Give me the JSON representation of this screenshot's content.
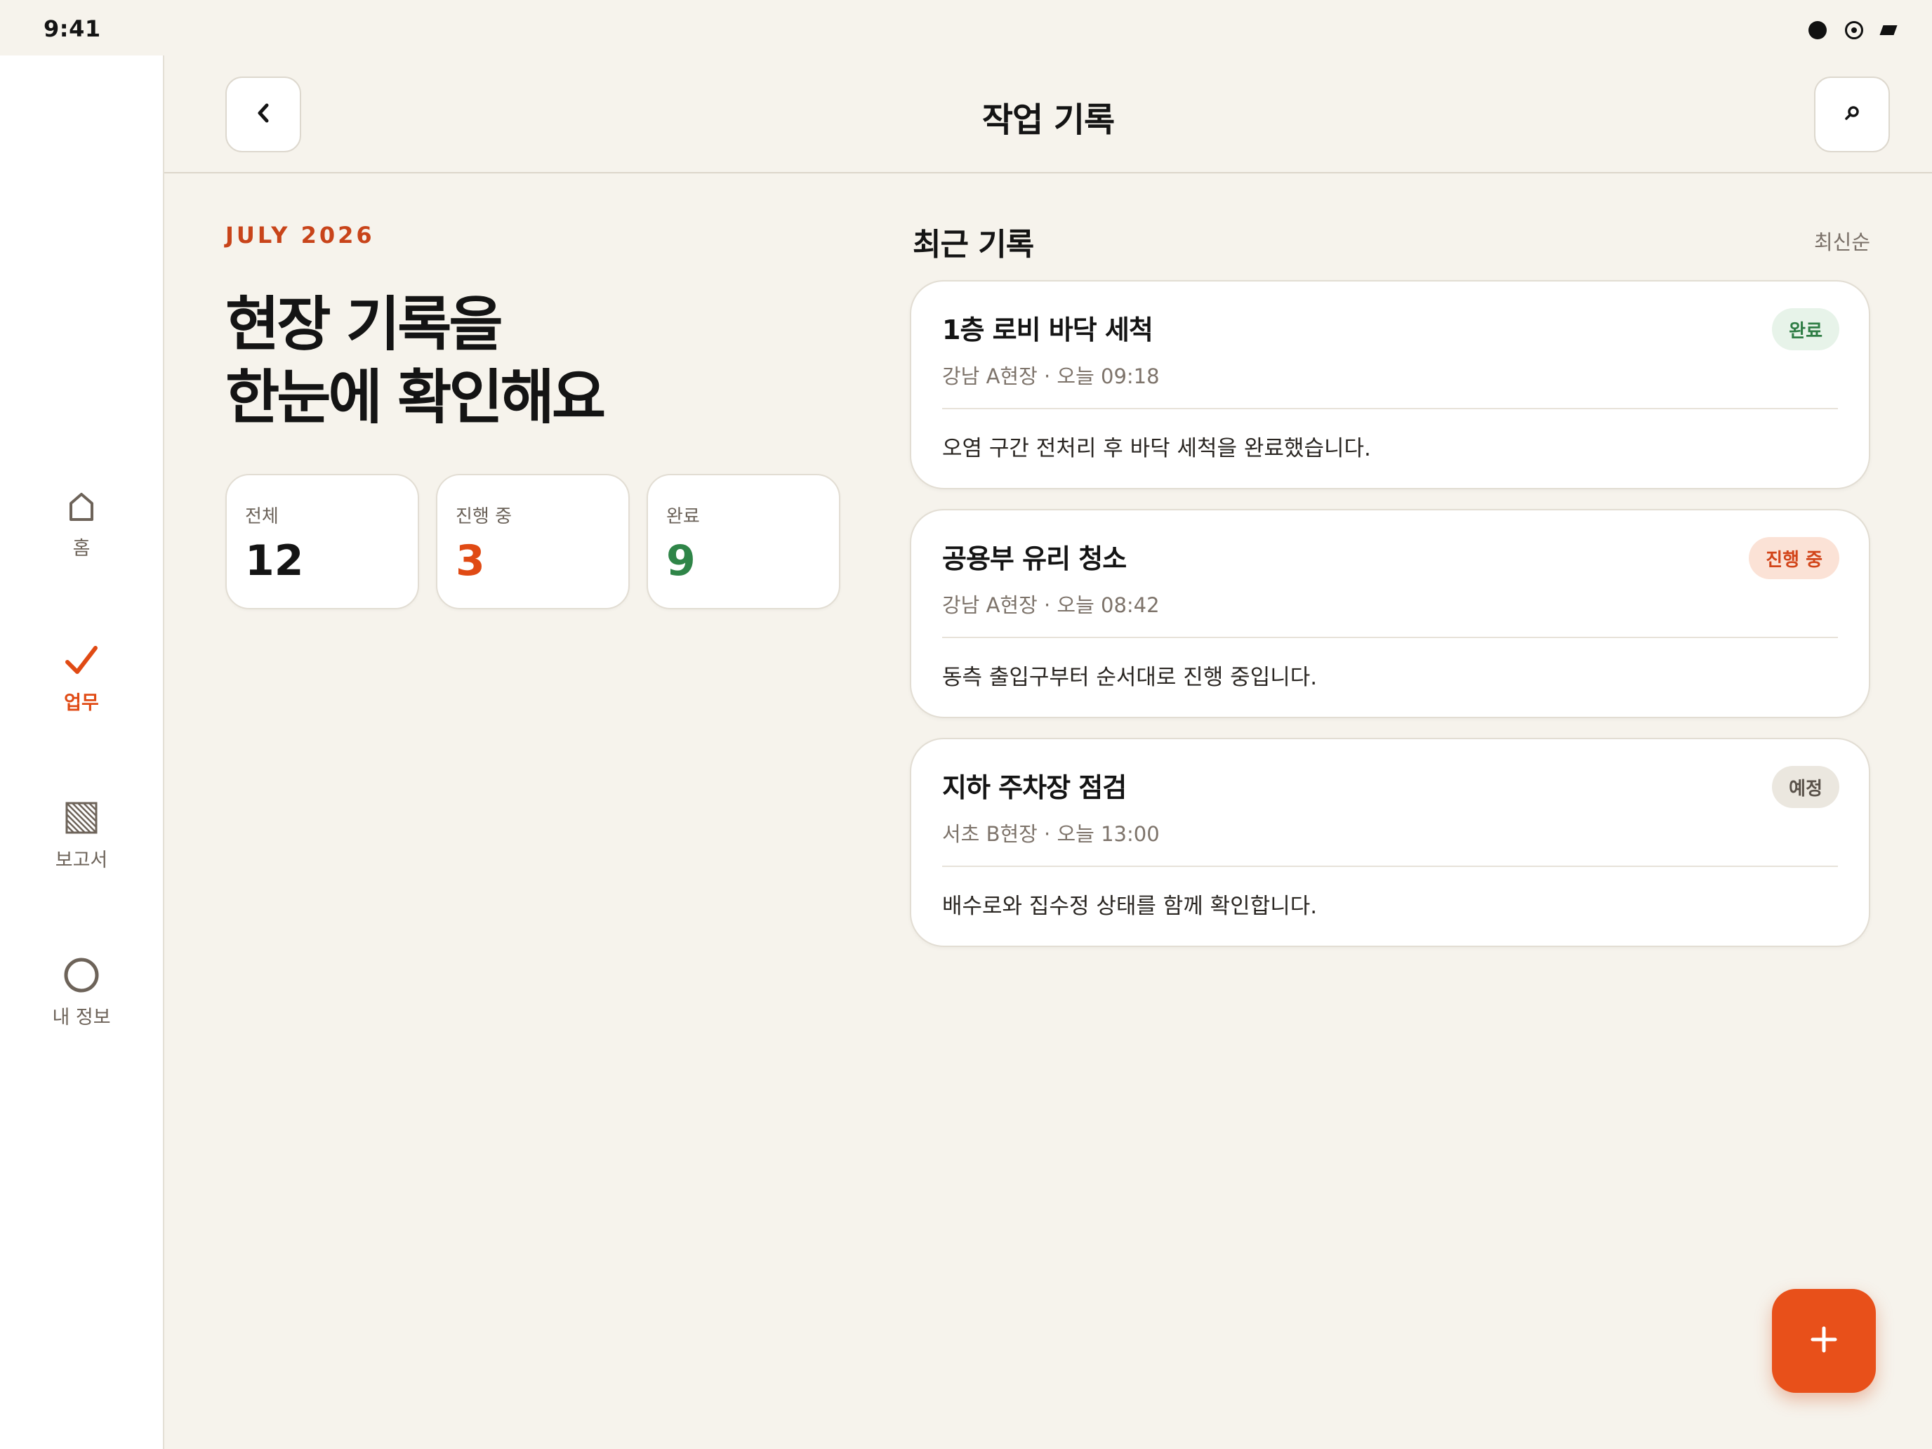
{
  "status_bar": {
    "time": "9:41"
  },
  "sidebar": {
    "items": [
      {
        "label": "홈",
        "icon": "home-icon"
      },
      {
        "label": "업무",
        "icon": "check-icon",
        "active": true
      },
      {
        "label": "보고서",
        "icon": "report-icon"
      },
      {
        "label": "내 정보",
        "icon": "profile-icon"
      }
    ]
  },
  "header": {
    "title": "작업 기록",
    "back_icon": "back-icon",
    "search_icon": "search-icon"
  },
  "summary": {
    "month": "JULY 2026",
    "hero_line1": "현장 기록을",
    "hero_line2": "한눈에 확인해요",
    "stats": [
      {
        "label": "전체",
        "value": "12"
      },
      {
        "label": "진행 중",
        "value": "3"
      },
      {
        "label": "완료",
        "value": "9"
      }
    ]
  },
  "recent": {
    "title": "최근 기록",
    "sort": "최신순",
    "records": [
      {
        "title": "1층 로비 바닥 세척",
        "meta": "강남 A현장 · 오늘 09:18",
        "desc": "오염 구간 전처리 후 바닥 세척을 완료했습니다.",
        "status": "완료"
      },
      {
        "title": "공용부 유리 청소",
        "meta": "강남 A현장 · 오늘 08:42",
        "desc": "동측 출입구부터 순서대로 진행 중입니다.",
        "status": "진행 중"
      },
      {
        "title": "지하 주차장 점검",
        "meta": "서초 B현장 · 오늘 13:00",
        "desc": "배수로와 집수정 상태를 함께 확인합니다.",
        "status": "예정"
      }
    ]
  },
  "fab": {
    "icon": "plus-icon"
  },
  "colors": {
    "accent": "#e8501a",
    "done": "#2f8548",
    "background": "#f6f3ec"
  }
}
